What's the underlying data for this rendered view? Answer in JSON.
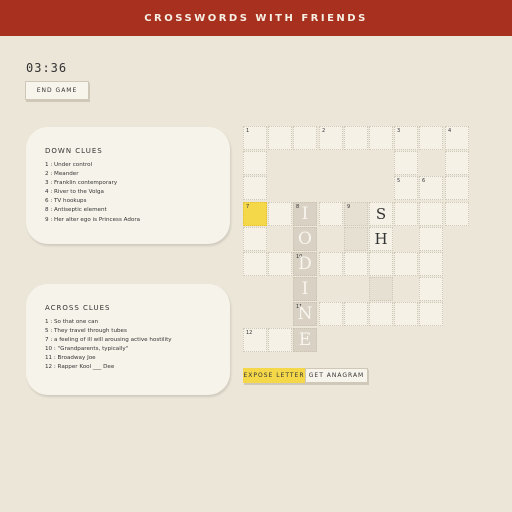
{
  "header": {
    "title": "CROSSWORDS WITH FRIENDS"
  },
  "timer": "03:36",
  "end_game_label": "END GAME",
  "down": {
    "heading": "DOWN CLUES",
    "clues": [
      "1 : Under control",
      "2 : Meander",
      "3 : Franklin contemporary",
      "4 : River to the Volga",
      "6 : TV hookups",
      "8 : Antiseptic element",
      "9 : Her alter ego is Princess Adora"
    ]
  },
  "across": {
    "heading": "ACROSS CLUES",
    "clues": [
      "1 : So that one can",
      "5 : They travel through tubes",
      "7 : a feeling of ill will arousing active hostility",
      "10 : \"Grandparents, typically\"",
      "11 : Broadway Joe",
      "12 : Rapper Kool ___ Dee"
    ]
  },
  "grid": {
    "columns": 9,
    "rows": 9,
    "cells": [
      {
        "r": 0,
        "c": 0,
        "num": "1"
      },
      {
        "r": 0,
        "c": 1
      },
      {
        "r": 0,
        "c": 2
      },
      {
        "r": 0,
        "c": 3,
        "num": "2"
      },
      {
        "r": 0,
        "c": 4
      },
      {
        "r": 0,
        "c": 5
      },
      {
        "r": 0,
        "c": 6,
        "num": "3"
      },
      {
        "r": 0,
        "c": 7
      },
      {
        "r": 0,
        "c": 8,
        "num": "4"
      },
      {
        "r": 1,
        "c": 0
      },
      {
        "r": 1,
        "c": 6
      },
      {
        "r": 1,
        "c": 8
      },
      {
        "r": 2,
        "c": 0
      },
      {
        "r": 2,
        "c": 6,
        "num": "5"
      },
      {
        "r": 2,
        "c": 7,
        "num": "6"
      },
      {
        "r": 2,
        "c": 8
      },
      {
        "r": 3,
        "c": 0,
        "num": "7",
        "state": "yellow"
      },
      {
        "r": 3,
        "c": 1
      },
      {
        "r": 3,
        "c": 2,
        "num": "8",
        "state": "word",
        "letter": "I"
      },
      {
        "r": 3,
        "c": 3
      },
      {
        "r": 3,
        "c": 4,
        "num": "9",
        "state": "shade"
      },
      {
        "r": 3,
        "c": 5,
        "letter": "S"
      },
      {
        "r": 3,
        "c": 6
      },
      {
        "r": 3,
        "c": 7
      },
      {
        "r": 3,
        "c": 8
      },
      {
        "r": 4,
        "c": 0
      },
      {
        "r": 4,
        "c": 2,
        "state": "word",
        "letter": "O"
      },
      {
        "r": 4,
        "c": 4,
        "state": "shade"
      },
      {
        "r": 4,
        "c": 5,
        "letter": "H"
      },
      {
        "r": 4,
        "c": 7
      },
      {
        "r": 5,
        "c": 0
      },
      {
        "r": 5,
        "c": 1
      },
      {
        "r": 5,
        "c": 2,
        "num": "10",
        "state": "word",
        "letter": "D"
      },
      {
        "r": 5,
        "c": 3
      },
      {
        "r": 5,
        "c": 4
      },
      {
        "r": 5,
        "c": 5
      },
      {
        "r": 5,
        "c": 6
      },
      {
        "r": 5,
        "c": 7
      },
      {
        "r": 6,
        "c": 2,
        "state": "word",
        "letter": "I"
      },
      {
        "r": 6,
        "c": 5,
        "state": "shade"
      },
      {
        "r": 6,
        "c": 7
      },
      {
        "r": 7,
        "c": 2,
        "num": "11",
        "state": "word",
        "letter": "N"
      },
      {
        "r": 7,
        "c": 3
      },
      {
        "r": 7,
        "c": 4
      },
      {
        "r": 7,
        "c": 5
      },
      {
        "r": 7,
        "c": 6
      },
      {
        "r": 7,
        "c": 7
      },
      {
        "r": 8,
        "c": 0,
        "num": "12"
      },
      {
        "r": 8,
        "c": 1
      },
      {
        "r": 8,
        "c": 2,
        "state": "word",
        "letter": "E"
      }
    ]
  },
  "buttons": {
    "expose_letter": "EXPOSE LETTER",
    "get_anagram": "GET ANAGRAM"
  }
}
